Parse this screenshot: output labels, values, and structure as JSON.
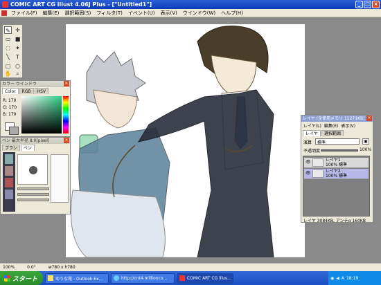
{
  "window": {
    "title": "COMIC ART CG illust 4.06J Plus - [\"Untitled1\"]"
  },
  "menu": [
    "ファイル(F)",
    "編集(E)",
    "選択範囲(S)",
    "フィルタ(T)",
    "イベント(U)",
    "表示(V)",
    "ウインドウ(W)",
    "ヘルプ(H)"
  ],
  "color_panel": {
    "title": "カラー ウインドウ",
    "tabs": [
      "Color",
      "RGB",
      "HSV"
    ],
    "r": "R: 170",
    "g": "G: 170",
    "b": "B: 170"
  },
  "pen_panel": {
    "title": "ペン 最大半径 8.0[pixel]",
    "tabs": [
      "ブラシ",
      "ペン"
    ]
  },
  "layer_panel": {
    "title": "レイヤ (全使用メモリ 11271KB)",
    "menu": [
      "レイヤ(L)",
      "編集(E)",
      "表示(V)"
    ],
    "tabs": [
      "レイヤ",
      "選択範囲"
    ],
    "mode_label": "演算",
    "mode_value": "標準",
    "opacity_label": "不透明度",
    "opacity_value": "100%",
    "layers": [
      {
        "name": "レイヤ1",
        "detail": "100% 標準",
        "selected": false
      },
      {
        "name": "レイヤ2",
        "detail": "100% 標準",
        "selected": true
      }
    ],
    "footer": "レイヤ 3084KB, アンチα 160KB"
  },
  "status": {
    "zoom": "100%",
    "angle": "0.0°",
    "size": "w780 x h780"
  },
  "taskbar": {
    "start": "スタート",
    "tasks": [
      {
        "label": "ゆうな苑 - Outlook Ex..."
      },
      {
        "label": "http://cnt4.millionco..."
      },
      {
        "label": "COMIC ART CG illus..."
      }
    ],
    "clock": "18:19"
  },
  "colors": {
    "accent": "#0a3cb8",
    "selected_layer": "#b8b8e8"
  }
}
